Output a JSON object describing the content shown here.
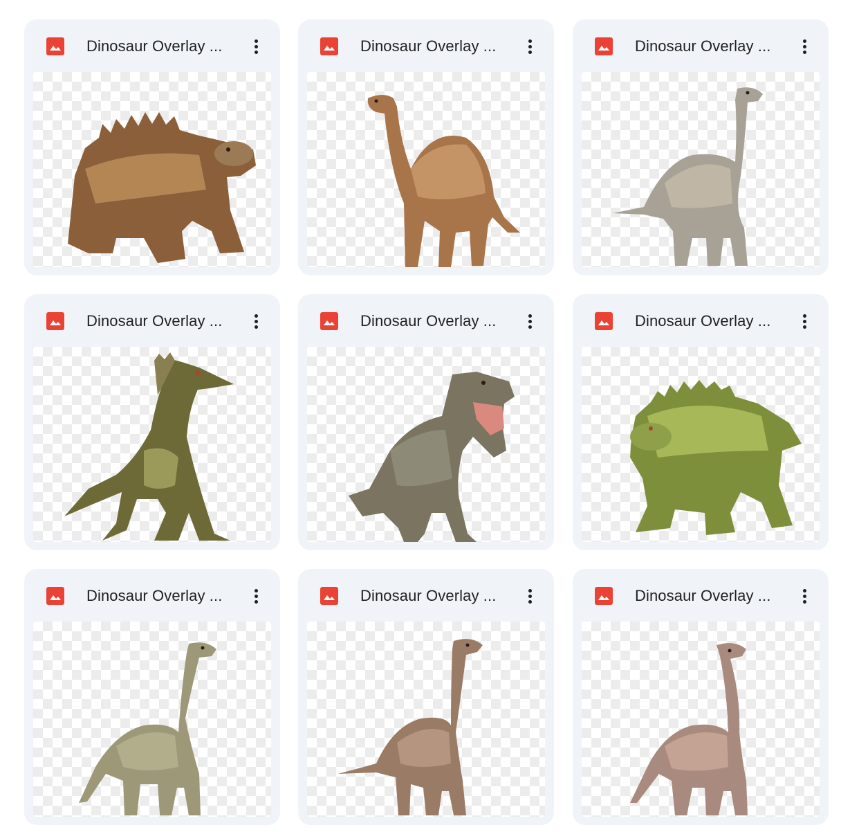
{
  "files": [
    {
      "title": "Dinosaur Overlay ...",
      "icon": "image-file-icon",
      "preview": "armored-dinosaur"
    },
    {
      "title": "Dinosaur Overlay ...",
      "icon": "image-file-icon",
      "preview": "long-neck-dinosaur-brown"
    },
    {
      "title": "Dinosaur Overlay ...",
      "icon": "image-file-icon",
      "preview": "long-neck-dinosaur-grey"
    },
    {
      "title": "Dinosaur Overlay ...",
      "icon": "image-file-icon",
      "preview": "feathered-raptor"
    },
    {
      "title": "Dinosaur Overlay ...",
      "icon": "image-file-icon",
      "preview": "t-rex"
    },
    {
      "title": "Dinosaur Overlay ...",
      "icon": "image-file-icon",
      "preview": "green-armored-dinosaur"
    },
    {
      "title": "Dinosaur Overlay ...",
      "icon": "image-file-icon",
      "preview": "long-neck-dinosaur-olive"
    },
    {
      "title": "Dinosaur Overlay ...",
      "icon": "image-file-icon",
      "preview": "long-neck-dinosaur-tan"
    },
    {
      "title": "Dinosaur Overlay ...",
      "icon": "image-file-icon",
      "preview": "long-neck-dinosaur-pink"
    }
  ],
  "colors": {
    "card_bg": "#f0f4f9",
    "icon_red": "#ea4335",
    "text": "#1f1f1f",
    "checker": "#ececec"
  }
}
